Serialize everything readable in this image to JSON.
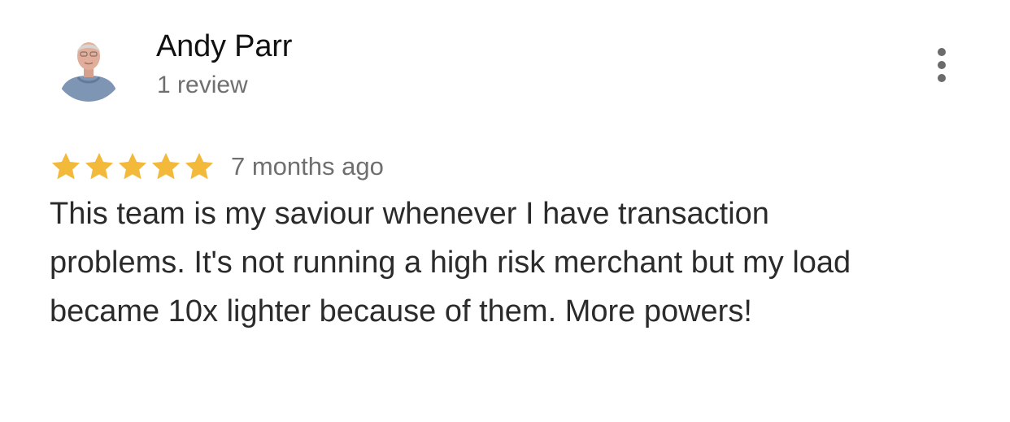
{
  "review": {
    "author": "Andy Parr",
    "review_count": "1 review",
    "rating": 5,
    "max_rating": 5,
    "timestamp": "7 months ago",
    "text": "This team is my saviour whenever I have transaction problems. It's not running a high risk merchant but my load became 10x lighter because of them. More powers!"
  },
  "icons": {
    "avatar": "avatar-photo",
    "star": "star-icon",
    "more": "more-vert-icon"
  },
  "colors": {
    "star": "#F2B93B",
    "name": "#111111",
    "secondary": "#6F6F6F",
    "body": "#2B2B2B",
    "more_icon": "#6B6B6B"
  }
}
